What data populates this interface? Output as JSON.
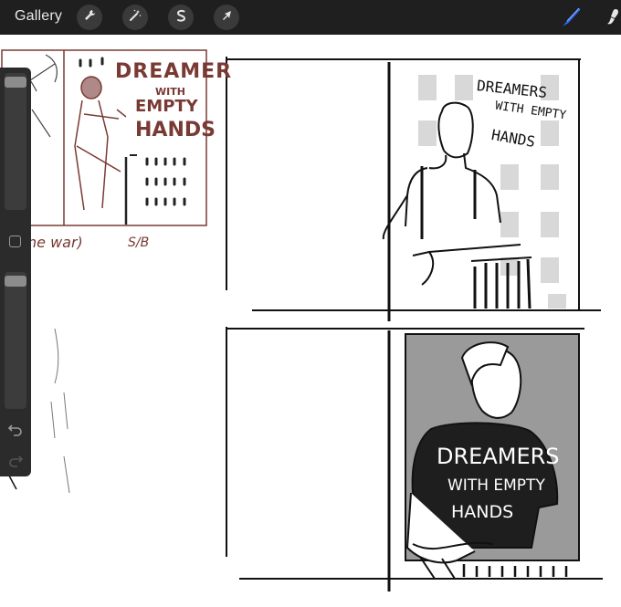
{
  "app": {
    "gallery_label": "Gallery"
  },
  "toolbar": {
    "actions_icon": "wrench-icon",
    "adjustments_icon": "magic-wand-icon",
    "selection_icon": "selection-s-icon",
    "transform_icon": "arrow-cursor-icon",
    "brush_icon": "brush-icon",
    "smudge_icon": "smudge-icon",
    "brush_color": "#2d6bff"
  },
  "sidebar": {
    "brush_size_level": 0.05,
    "opacity_level": 0.05,
    "undo_icon": "undo-icon",
    "redo_icon": "redo-icon"
  },
  "artwork": {
    "reference_title_line1": "DREAMER",
    "reference_title_line2": "WITH",
    "reference_title_line3": "EMPTY",
    "reference_title_line4": "HANDS",
    "reference_note": "ne war)",
    "reference_signature": "S/B",
    "panel1_text_line1": "DREAMERS",
    "panel1_text_line2": "WITH EMPTY",
    "panel1_text_line3": "HANDS",
    "panel2_shirt_line1": "DREAMERS",
    "panel2_shirt_line2": "WITH EMPTY",
    "panel2_shirt_line3": "HANDS"
  }
}
